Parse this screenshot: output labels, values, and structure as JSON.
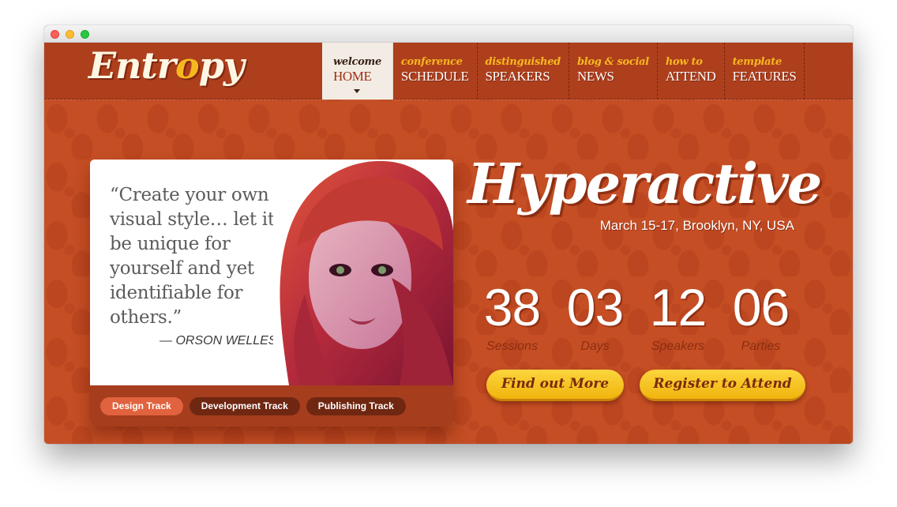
{
  "logo": {
    "text_a": "Entr",
    "text_o": "o",
    "text_b": "py"
  },
  "nav": [
    {
      "sub": "welcome",
      "main": "HOME",
      "active": true
    },
    {
      "sub": "conference",
      "main": "SCHEDULE"
    },
    {
      "sub": "distinguished",
      "main": "SPEAKERS"
    },
    {
      "sub": "blog & social",
      "main": "NEWS"
    },
    {
      "sub": "how to",
      "main": "ATTEND"
    },
    {
      "sub": "template",
      "main": "FEATURES"
    }
  ],
  "quote": {
    "text": "“Create your own visual style… let it be unique for yourself and yet identifiable for others.”",
    "author": "— ORSON WELLES"
  },
  "tracks": [
    "Design Track",
    "Development Track",
    "Publishing Track"
  ],
  "hero": {
    "title": "Hyperactive",
    "date": "March 15-17, Brooklyn, NY, USA"
  },
  "stats": [
    {
      "number": "38",
      "label": "Sessions"
    },
    {
      "number": "03",
      "label": "Days"
    },
    {
      "number": "12",
      "label": "Speakers"
    },
    {
      "number": "06",
      "label": "Parties"
    }
  ],
  "buttons": {
    "more": "Find out More",
    "register": "Register to Attend"
  },
  "colors": {
    "background": "#c54e24",
    "header": "#ae3f1d",
    "accent": "#f5b821",
    "track_active": "#e1623e"
  }
}
